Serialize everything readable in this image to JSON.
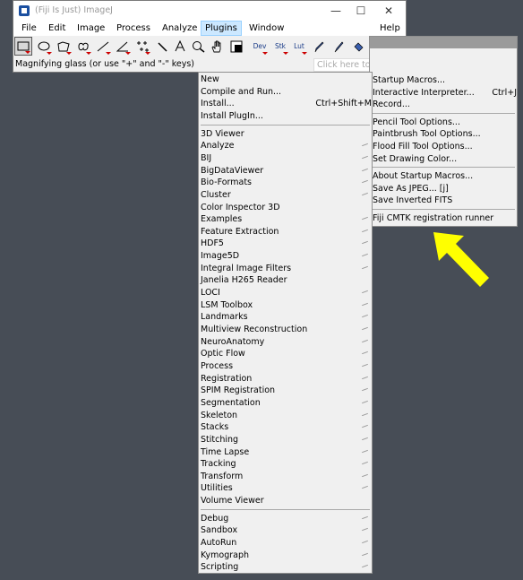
{
  "window": {
    "title": "(Fiji Is Just) ImageJ",
    "controls": [
      "—",
      "☐",
      "✕"
    ]
  },
  "menubar": [
    "File",
    "Edit",
    "Image",
    "Process",
    "Analyze",
    "Plugins",
    "Window",
    "Help"
  ],
  "toolbar": {
    "tools": [
      "rectangle-tool",
      "oval-tool",
      "polygon-tool",
      "freehand-tool",
      "line-tool",
      "angle-tool",
      "multipoint-tool",
      "wand-tool",
      "text-tool",
      "magnifier-tool",
      "hand-tool",
      "color-picker-tool"
    ],
    "dev": "Dev",
    "stk": "Stk",
    "lut": "Lut"
  },
  "status": {
    "text": "Magnifying glass (or use \"+\" and \"-\" keys)",
    "search_placeholder": "Click here to search"
  },
  "plugins_menu": {
    "top": [
      {
        "label": "New",
        "shortcut": "",
        "submenu": false
      },
      {
        "label": "Compile and Run...",
        "shortcut": ""
      },
      {
        "label": "Install...",
        "shortcut": "Ctrl+Shift+M"
      },
      {
        "label": "Install PlugIn...",
        "shortcut": ""
      }
    ],
    "group1": [
      {
        "label": "3D Viewer",
        "submenu": false
      },
      {
        "label": "Analyze",
        "submenu": true
      },
      {
        "label": "BIJ",
        "submenu": true
      },
      {
        "label": "BigDataViewer",
        "submenu": true
      },
      {
        "label": "Bio-Formats",
        "submenu": true
      },
      {
        "label": "Cluster",
        "submenu": true
      },
      {
        "label": "Color Inspector 3D",
        "submenu": false
      },
      {
        "label": "Examples",
        "submenu": true
      },
      {
        "label": "Feature Extraction",
        "submenu": true
      },
      {
        "label": "HDF5",
        "submenu": true
      },
      {
        "label": "Image5D",
        "submenu": true
      },
      {
        "label": "Integral Image Filters",
        "submenu": true
      },
      {
        "label": "Janelia H265 Reader",
        "submenu": false
      },
      {
        "label": "LOCI",
        "submenu": true
      },
      {
        "label": "LSM Toolbox",
        "submenu": true
      },
      {
        "label": "Landmarks",
        "submenu": true
      },
      {
        "label": "Multiview Reconstruction",
        "submenu": true
      },
      {
        "label": "NeuroAnatomy",
        "submenu": true
      },
      {
        "label": "Optic Flow",
        "submenu": true
      },
      {
        "label": "Process",
        "submenu": true
      },
      {
        "label": "Registration",
        "submenu": true
      },
      {
        "label": "SPIM Registration",
        "submenu": true
      },
      {
        "label": "Segmentation",
        "submenu": true
      },
      {
        "label": "Skeleton",
        "submenu": true
      },
      {
        "label": "Stacks",
        "submenu": true
      },
      {
        "label": "Stitching",
        "submenu": true
      },
      {
        "label": "Time Lapse",
        "submenu": true
      },
      {
        "label": "Tracking",
        "submenu": true
      },
      {
        "label": "Transform",
        "submenu": true
      },
      {
        "label": "Utilities",
        "submenu": true
      },
      {
        "label": "Volume Viewer",
        "submenu": false
      }
    ],
    "group2": [
      {
        "label": "Debug",
        "submenu": true
      },
      {
        "label": "Sandbox",
        "submenu": true
      },
      {
        "label": "AutoRun",
        "submenu": true
      },
      {
        "label": "Kymograph",
        "submenu": true
      },
      {
        "label": "Scripting",
        "submenu": true
      }
    ]
  },
  "right_menu": {
    "group1": [
      {
        "label": "Startup Macros...",
        "shortcut": ""
      },
      {
        "label": "Interactive Interpreter...",
        "shortcut": "Ctrl+J"
      },
      {
        "label": "Record...",
        "shortcut": ""
      }
    ],
    "group2": [
      {
        "label": "Pencil Tool Options..."
      },
      {
        "label": "Paintbrush Tool Options..."
      },
      {
        "label": "Flood Fill Tool Options..."
      },
      {
        "label": "Set Drawing Color..."
      }
    ],
    "group3": [
      {
        "label": "About Startup Macros..."
      },
      {
        "label": "Save As JPEG... [j]"
      },
      {
        "label": "Save Inverted FITS"
      }
    ],
    "group4": [
      {
        "label": "Fiji CMTK registration runner"
      }
    ]
  },
  "colors": {
    "arrow": "#ffff00",
    "background": "#474d56",
    "menu_bg": "#f0f0f0",
    "active_menu": "#cce8ff"
  }
}
